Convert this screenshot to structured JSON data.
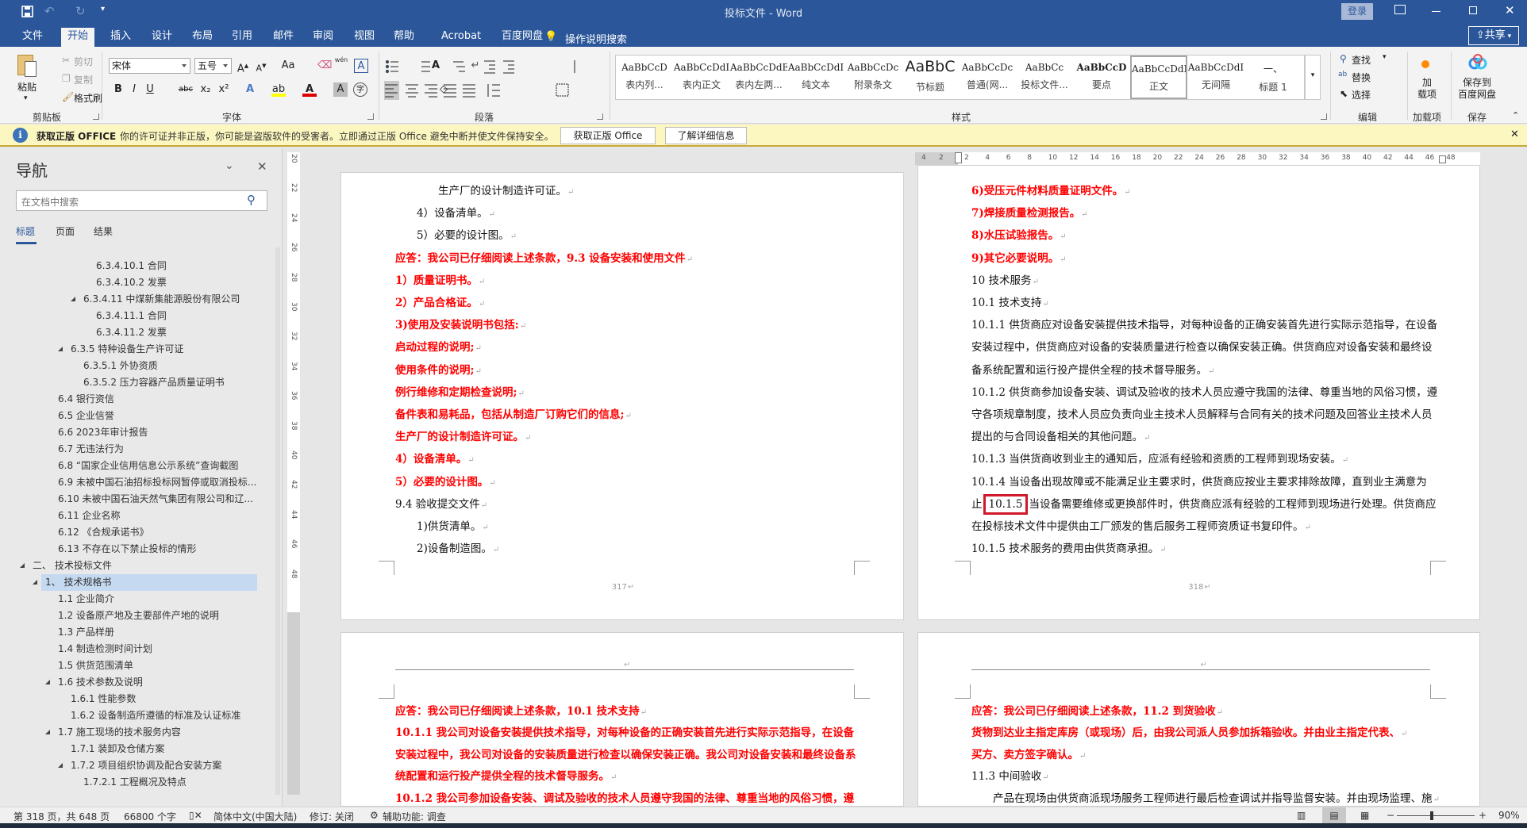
{
  "window": {
    "title": "投标文件 - Word",
    "login": "登录",
    "share": "共享"
  },
  "tabs": [
    "文件",
    "开始",
    "插入",
    "设计",
    "布局",
    "引用",
    "邮件",
    "审阅",
    "视图",
    "帮助",
    "Acrobat",
    "百度网盘"
  ],
  "active_tab": "开始",
  "tell_me": "操作说明搜索",
  "ribbon": {
    "clipboard": {
      "paste": "粘贴",
      "cut": "剪切",
      "copy": "复制",
      "format_painter": "格式刷",
      "label": "剪贴板"
    },
    "font": {
      "name": "宋体",
      "size": "五号",
      "label": "字体",
      "format_buttons": [
        "B",
        "I",
        "U",
        "abc",
        "x₂",
        "x²"
      ],
      "case_button": "Aa",
      "phonetic": "wén",
      "char_border": "A",
      "enclose": "字"
    },
    "paragraph": {
      "label": "段落"
    },
    "styles": {
      "label": "样式",
      "items": [
        {
          "preview": "AaBbCcD",
          "name": "表内列...",
          "mark": true
        },
        {
          "preview": "AaBbCcDdI",
          "name": "表内正文",
          "mark": false
        },
        {
          "preview": "AaBbCcDdEe",
          "name": "表内左两...",
          "mark": false
        },
        {
          "preview": "AaBbCcDdI",
          "name": "纯文本",
          "mark": false
        },
        {
          "preview": "AaBbCcDc",
          "name": "附录条文",
          "mark": true
        },
        {
          "preview": "AaBbC",
          "name": "节标题",
          "mark": false
        },
        {
          "preview": "AaBbCcDc",
          "name": "普通(网...",
          "mark": true
        },
        {
          "preview": "AaBbCc",
          "name": "投标文件...",
          "mark": false
        },
        {
          "preview": "AaBbCcD",
          "name": "要点",
          "mark": false
        },
        {
          "preview": "AaBbCcDdI",
          "name": "正文",
          "mark": true,
          "selected": true
        },
        {
          "preview": "AaBbCcDdI",
          "name": "无间隔",
          "mark": true
        },
        {
          "preview": "一、",
          "name": "标题 1",
          "mark": false
        }
      ]
    },
    "editing": {
      "find": "查找",
      "replace": "替换",
      "select": "选择",
      "label": "编辑"
    },
    "addins": {
      "button_lines": [
        "加",
        "载项"
      ],
      "label": "加载项"
    },
    "save": {
      "button_lines": [
        "保存到",
        "百度网盘"
      ],
      "label": "保存"
    }
  },
  "infobar": {
    "title": "获取正版 OFFICE",
    "message": "你的许可证并非正版，你可能是盗版软件的受害者。立即通过正版 Office 避免中断并使文件保持安全。",
    "button_primary": "获取正版 Office",
    "button_secondary": "了解详细信息"
  },
  "nav": {
    "title": "导航",
    "search_placeholder": "在文档中搜索",
    "tabs": [
      "标题",
      "页面",
      "结果"
    ],
    "items": [
      {
        "text": "6.3.4.10.1 合同",
        "level": 5
      },
      {
        "text": "6.3.4.10.2 发票",
        "level": 5
      },
      {
        "text": "6.3.4.11 中煤新集能源股份有限公司",
        "level": 4,
        "expanded": true
      },
      {
        "text": "6.3.4.11.1 合同",
        "level": 5
      },
      {
        "text": "6.3.4.11.2 发票",
        "level": 5
      },
      {
        "text": "6.3.5 特种设备生产许可证",
        "level": 3,
        "expanded": true
      },
      {
        "text": "6.3.5.1 外协资质",
        "level": 4
      },
      {
        "text": "6.3.5.2 压力容器产品质量证明书",
        "level": 4
      },
      {
        "text": "6.4 银行资信",
        "level": 2
      },
      {
        "text": "6.5 企业信誉",
        "level": 2
      },
      {
        "text": "6.6 2023年审计报告",
        "level": 2
      },
      {
        "text": "6.7 无违法行为",
        "level": 2
      },
      {
        "text": "6.8 “国家企业信用信息公示系统”查询截图",
        "level": 2
      },
      {
        "text": "6.9 未被中国石油招标投标网暂停或取消投标...",
        "level": 2
      },
      {
        "text": "6.10 未被中国石油天然气集团有限公司和辽...",
        "level": 2
      },
      {
        "text": "6.11 企业名称",
        "level": 2
      },
      {
        "text": "6.12 《合规承诺书》",
        "level": 2
      },
      {
        "text": "6.13 不存在以下禁止投标的情形",
        "level": 2
      },
      {
        "text": "二、 技术投标文件",
        "level": 0,
        "expanded": true
      },
      {
        "text": "1、 技术规格书",
        "level": 1,
        "expanded": true,
        "selected": true
      },
      {
        "text": "1.1 企业简介",
        "level": 2
      },
      {
        "text": "1.2 设备原产地及主要部件产地的说明",
        "level": 2
      },
      {
        "text": "1.3 产品样册",
        "level": 2
      },
      {
        "text": "1.4 制造检测时间计划",
        "level": 2
      },
      {
        "text": "1.5 供货范围清单",
        "level": 2
      },
      {
        "text": "1.6 技术参数及说明",
        "level": 2,
        "expanded": true
      },
      {
        "text": "1.6.1 性能参数",
        "level": 3
      },
      {
        "text": "1.6.2 设备制造所遵循的标准及认证标准",
        "level": 3
      },
      {
        "text": "1.7 施工现场的技术服务内容",
        "level": 2,
        "expanded": true
      },
      {
        "text": "1.7.1 装卸及仓储方案",
        "level": 3
      },
      {
        "text": "1.7.2 项目组织协调及配合安装方案",
        "level": 3,
        "expanded": true
      },
      {
        "text": "1.7.2.1 工程概况及特点",
        "level": 4
      }
    ]
  },
  "ruler": {
    "horizontal": [
      "4",
      "2",
      "2",
      "4",
      "6",
      "8",
      "10",
      "12",
      "14",
      "16",
      "18",
      "20",
      "22",
      "24",
      "26",
      "28",
      "30",
      "32",
      "34",
      "36",
      "38",
      "40",
      "42",
      "44",
      "46",
      "48"
    ],
    "vertical": [
      "20",
      "22",
      "24",
      "26",
      "28",
      "30",
      "32",
      "34",
      "36",
      "38",
      "40",
      "42",
      "44",
      "46",
      "48"
    ]
  },
  "pages": [
    {
      "number": "317",
      "lines": [
        {
          "text": "生产厂的设计制造许可证。",
          "indent": 2
        },
        {
          "text": "4）设备清单。",
          "indent": 1
        },
        {
          "text": "5）必要的设计图。",
          "indent": 1
        },
        {
          "text": "应答：我公司已仔细阅读上述条款，9.3 设备安装和使用文件",
          "red": true
        },
        {
          "text": "1）质量证明书。",
          "red": true
        },
        {
          "text": "2）产品合格证。",
          "red": true
        },
        {
          "text": "3)使用及安装说明书包括:",
          "red": true
        },
        {
          "text": "启动过程的说明;",
          "red": true
        },
        {
          "text": "使用条件的说明;",
          "red": true
        },
        {
          "text": "例行维修和定期检查说明;",
          "red": true
        },
        {
          "text": "备件表和易耗品，包括从制造厂订购它们的信息;",
          "red": true
        },
        {
          "text": "生产厂的设计制造许可证。",
          "red": true
        },
        {
          "text": "4）设备清单。",
          "red": true
        },
        {
          "text": "5）必要的设计图。",
          "red": true
        },
        {
          "text": "9.4 验收提交文件"
        },
        {
          "text": "1)供货清单。",
          "indent": 1
        },
        {
          "text": "2)设备制造图。",
          "indent": 1
        }
      ]
    },
    {
      "number": "318",
      "lines": [
        {
          "text": "6)受压元件材料质量证明文件。",
          "red": true
        },
        {
          "text": "7)焊接质量检测报告。",
          "red": true
        },
        {
          "text": "8)水压试验报告。",
          "red": true
        },
        {
          "text": "9)其它必要说明。",
          "red": true
        },
        {
          "text": "10 技术服务"
        },
        {
          "text": "10.1 技术支持"
        },
        {
          "text": "10.1.1 供货商应对设备安装提供技术指导，对每种设备的正确安装首先进行实际示范指导，在设备",
          "wrap": true
        },
        {
          "text": "安装过程中，供货商应对设备的安装质量进行检查以确保安装正确。供货商应对设备安装和最终设",
          "wrap": true
        },
        {
          "text": "备系统配置和运行投产提供全程的技术督导服务。"
        },
        {
          "text": "10.1.2 供货商参加设备安装、调试及验收的技术人员应遵守我国的法律、尊重当地的风俗习惯，遵",
          "wrap": true
        },
        {
          "text": "守各项规章制度，技术人员应负责向业主技术人员解释与合同有关的技术问题及回答业主技术人员",
          "wrap": true
        },
        {
          "text": "提出的与合同设备相关的其他问题。"
        },
        {
          "text": "10.1.3 当供货商收到业主的通知后，应派有经验和资质的工程师到现场安装。"
        },
        {
          "text": "10.1.4 当设备出现故障或不能满足业主要求时，供货商应按业主要求排除故障，直到业主满意为",
          "wrap": true
        },
        {
          "text": "止",
          "boxed": "10.1.5",
          "rest": "当设备需要维修或更换部件时，供货商应派有经验的工程师到现场进行处理。供货商应",
          "wrap": true
        },
        {
          "text": "在投标技术文件中提供由工厂颁发的售后服务工程师资质证书复印件。"
        },
        {
          "text": "10.1.5 技术服务的费用由供货商承担。"
        }
      ]
    },
    {
      "number": "",
      "lines": [
        {
          "text": "应答：我公司已仔细阅读上述条款，10.1 技术支持",
          "red": true
        },
        {
          "text": "10.1.1 我公司对设备安装提供技术指导，对每种设备的正确安装首先进行实际示范指导，在设备",
          "red": true,
          "wrap": true
        },
        {
          "text": "安装过程中，我公司对设备的安装质量进行检查以确保安装正确。我公司对设备安装和最终设备系",
          "red": true,
          "wrap": true
        },
        {
          "text": "统配置和运行投产提供全程的技术督导服务。",
          "red": true
        },
        {
          "text": "10.1.2 我公司参加设备安装、调试及验收的技术人员遵守我国的法律、尊重当地的风俗习惯，遵",
          "red": true,
          "wrap": true
        }
      ]
    },
    {
      "number": "",
      "lines": [
        {
          "text": "应答：我公司已仔细阅读上述条款，11.2 到货验收",
          "red": true
        },
        {
          "text": "货物到达业主指定库房（或现场）后，由我公司派人员参加拆箱验收。并由业主指定代表、",
          "red": true
        },
        {
          "text": "买方、卖方签字确认。",
          "red": true
        },
        {
          "text": "11.3 中间验收"
        },
        {
          "text": "产品在现场由供货商派现场服务工程师进行最后检查调试并指导监督安装。并由现场监理、施",
          "indent": 1
        }
      ]
    }
  ],
  "status": {
    "page": "第 318 页，共 648 页",
    "words": "66800 个字",
    "language": "简体中文(中国大陆)",
    "track_changes": "修订: 关闭",
    "accessibility": "辅助功能: 调查",
    "zoom": "90%",
    "zoom_value": 90
  },
  "colors": {
    "brand": "#2b579a",
    "red_text": "#ff0000",
    "highlight_box": "#d0182a",
    "infobar": "#fcf7c0"
  }
}
